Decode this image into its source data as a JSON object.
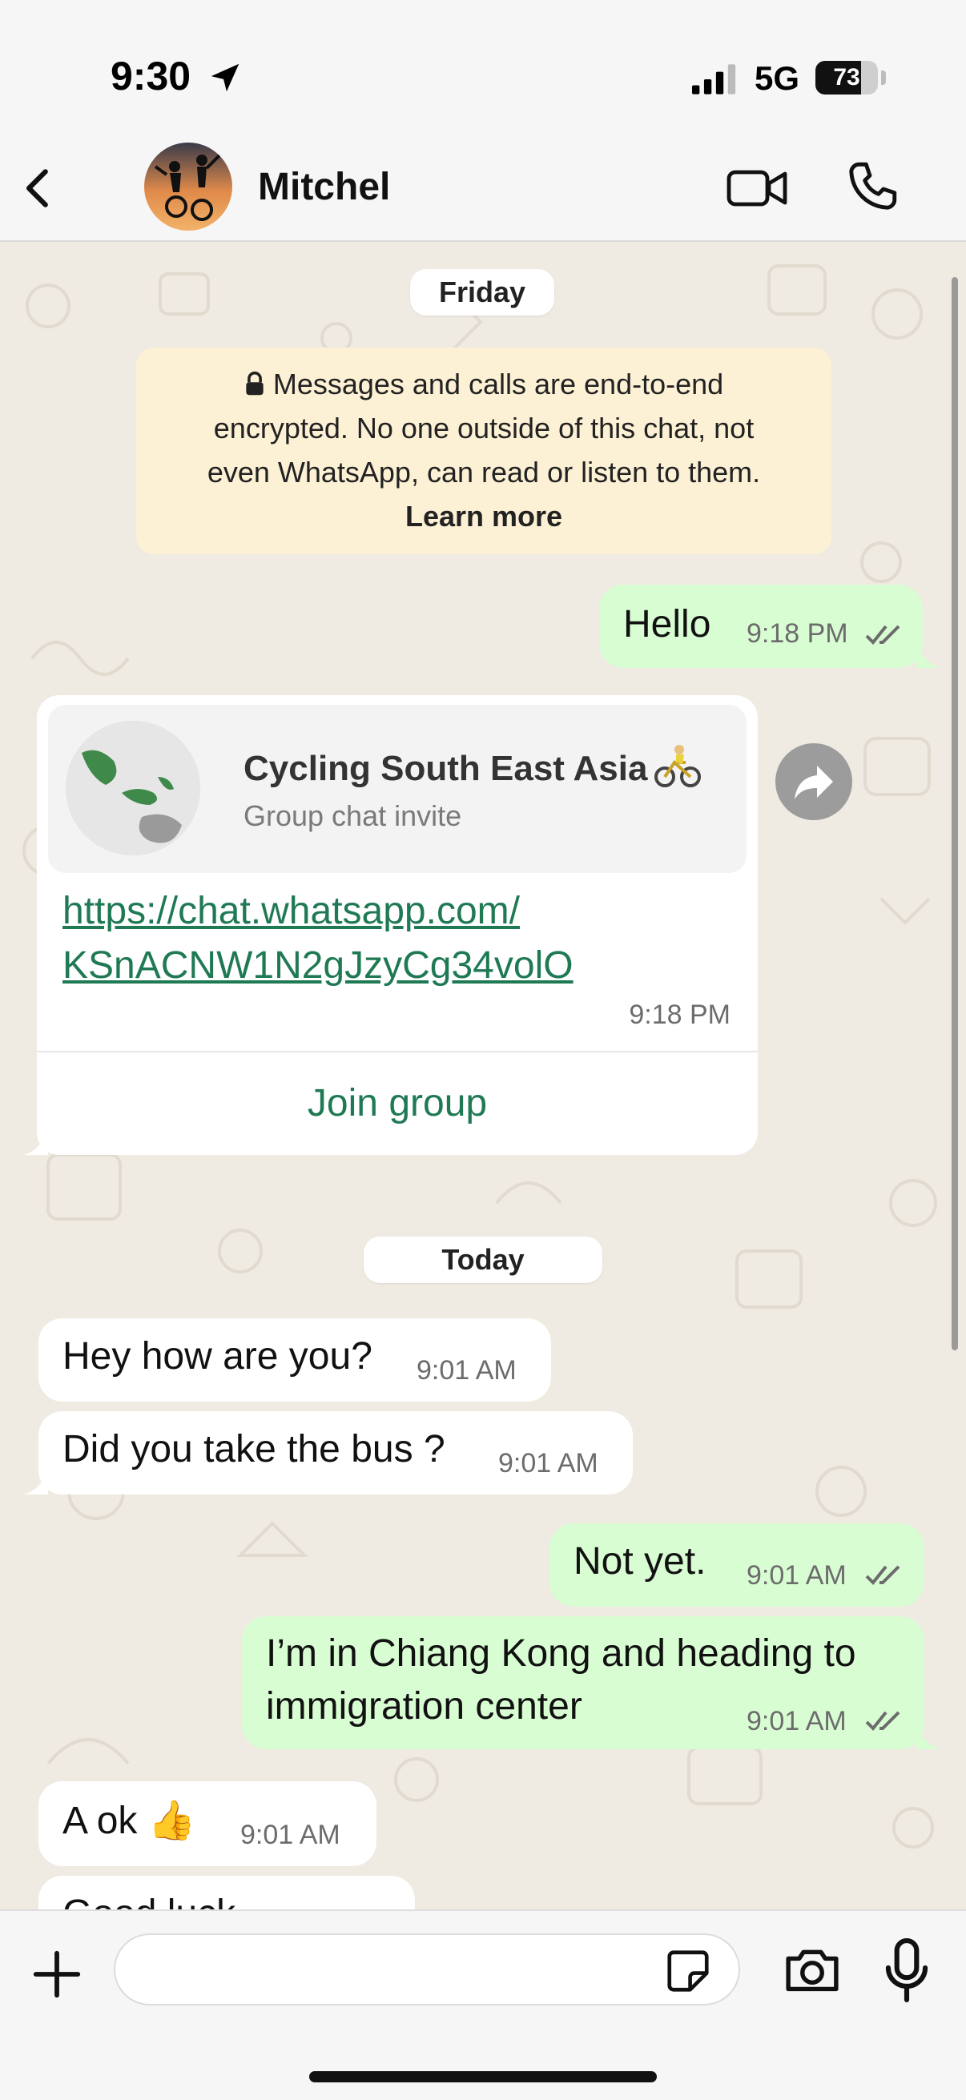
{
  "status_bar": {
    "time": "9:30",
    "network": "5G",
    "battery_level": "73",
    "battery_fraction": 0.73,
    "icons": [
      "location-arrow-icon",
      "signal-icon"
    ]
  },
  "header": {
    "contact_name": "Mitchel",
    "icons": [
      "back-icon",
      "video-call-icon",
      "voice-call-icon"
    ]
  },
  "chat": {
    "date_friday": "Friday",
    "encryption_notice": "Messages and calls are end-to-end encrypted. No one outside of this chat, not even WhatsApp, can read or listen to them.",
    "encryption_line1": "Messages and calls are end-to-end",
    "encryption_line2": "encrypted. No one outside of this chat, not",
    "encryption_line3": "even WhatsApp, can read or listen to them.",
    "learn_more": "Learn more",
    "msg_hello": {
      "text": "Hello",
      "time": "9:18 PM",
      "status": "read"
    },
    "invite": {
      "title": "Cycling South East Asia",
      "subtitle": "Group chat invite",
      "link_line1": "https://chat.whatsapp.com/",
      "link_line2": "KSnACNW1N2gJzyCg34volO",
      "time": "9:18 PM",
      "join_label": "Join group"
    },
    "date_today": "Today",
    "msg_hey": {
      "text": "Hey how are you?",
      "time": "9:01 AM"
    },
    "msg_bus": {
      "text": "Did you take the bus ?",
      "time": "9:01 AM"
    },
    "msg_notyet": {
      "text": "Not yet.",
      "time": "9:01 AM",
      "status": "read"
    },
    "msg_chiang": {
      "line1": "I’m in Chiang Kong and heading to",
      "line2": "immigration center",
      "time": "9:01 AM",
      "status": "read"
    },
    "msg_aok": {
      "text": "A ok 👍",
      "time": "9:01 AM"
    },
    "msg_goodluck": {
      "text": "Good luck"
    }
  },
  "composer": {
    "placeholder": "",
    "icons": [
      "plus-icon",
      "sticker-icon",
      "camera-icon",
      "microphone-icon"
    ]
  }
}
